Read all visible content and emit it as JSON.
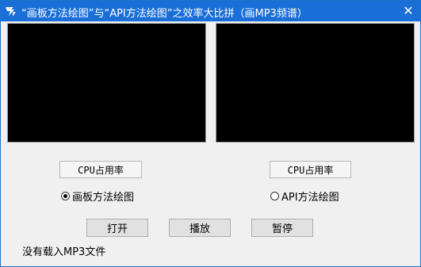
{
  "window": {
    "title": "“画板方法绘图”与“API方法绘图”之效率大比拼（画MP3频谱）",
    "close_label": "✕",
    "title_color": "#1a6ed8"
  },
  "panels": {
    "left": {
      "cpu_label": "CPU占用率",
      "radio_label": "画板方法绘图",
      "selected": true
    },
    "right": {
      "cpu_label": "CPU占用率",
      "radio_label": "API方法绘图",
      "selected": false
    }
  },
  "buttons": {
    "open": "打开",
    "play": "播放",
    "pause": "暂停"
  },
  "status": {
    "text": "没有载入MP3文件"
  },
  "icons": {
    "app": "app-logo-icon",
    "close": "close-icon"
  }
}
